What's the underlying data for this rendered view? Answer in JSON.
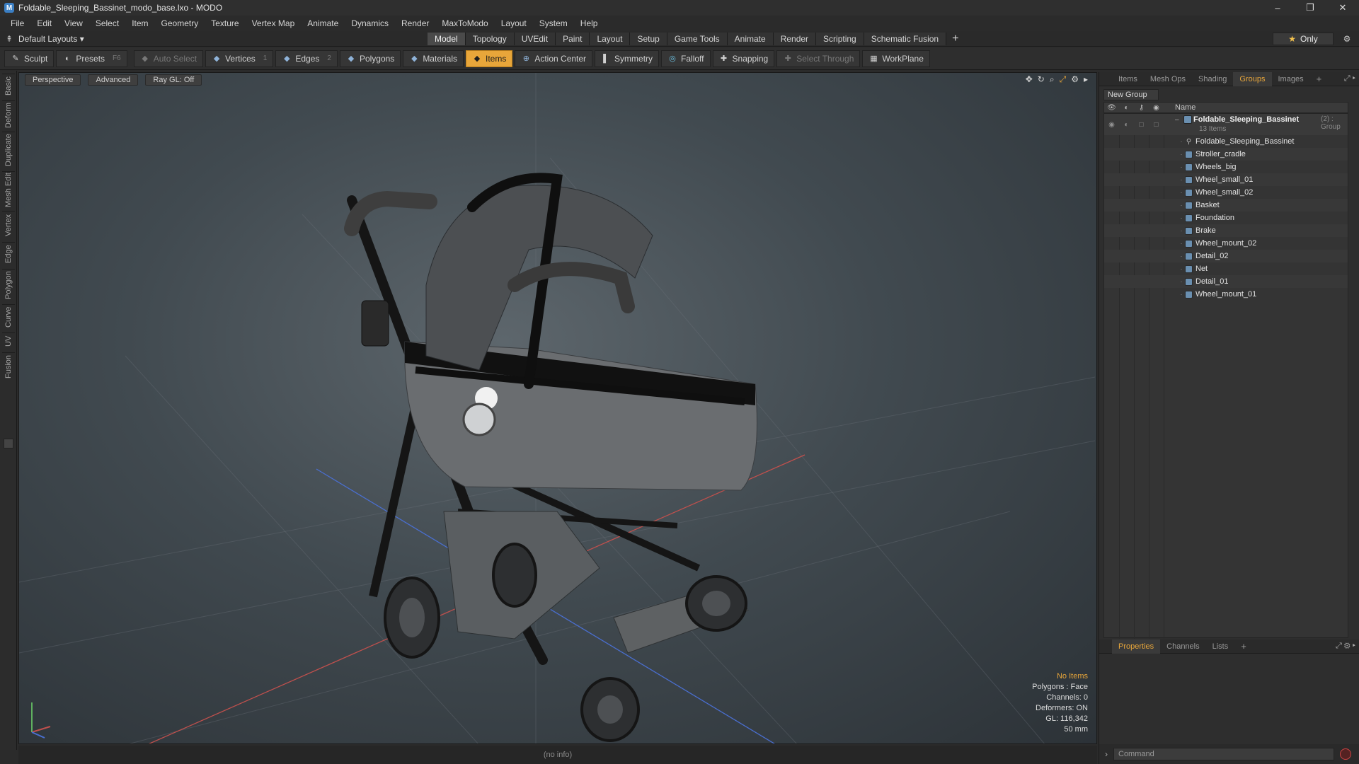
{
  "window": {
    "title": "Foldable_Sleeping_Bassinet_modo_base.lxo - MODO",
    "controls": [
      "–",
      "❐",
      "✕"
    ]
  },
  "menu": [
    "File",
    "Edit",
    "View",
    "Select",
    "Item",
    "Geometry",
    "Texture",
    "Vertex Map",
    "Animate",
    "Dynamics",
    "Render",
    "MaxToModo",
    "Layout",
    "System",
    "Help"
  ],
  "layouts": {
    "label": "Default Layouts ▾"
  },
  "tabs": {
    "items": [
      "Model",
      "Topology",
      "UVEdit",
      "Paint",
      "Layout",
      "Setup",
      "Game Tools",
      "Animate",
      "Render",
      "Scripting",
      "Schematic Fusion"
    ],
    "active": "Model",
    "plus": "+",
    "only_label": "Only",
    "only_icon": "★"
  },
  "toolbar": {
    "sculpt": "Sculpt",
    "presets": "Presets",
    "presets_key": "F6",
    "auto_select": "Auto Select",
    "vertices": "Vertices",
    "vertices_key": "1",
    "edges": "Edges",
    "edges_key": "2",
    "polygons": "Polygons",
    "materials": "Materials",
    "items": "Items",
    "action_center": "Action Center",
    "symmetry": "Symmetry",
    "falloff": "Falloff",
    "snapping": "Snapping",
    "select_through": "Select Through",
    "workplane": "WorkPlane"
  },
  "left_tabs": [
    "Basic",
    "Deform",
    "Duplicate",
    "Mesh Edit",
    "Vertex",
    "Edge",
    "Polygon",
    "Curve",
    "UV",
    "Fusion"
  ],
  "viewport": {
    "view_mode": "Perspective",
    "shading": "Advanced",
    "raygl": "Ray GL: Off",
    "info": {
      "selection": "No Items",
      "polygons": "Polygons : Face",
      "channels": "Channels: 0",
      "deformers": "Deformers: ON",
      "gl": "GL: 116,342",
      "distance": "50 mm"
    }
  },
  "status": {
    "text": "(no info)"
  },
  "right_panel": {
    "tabs": [
      "Items",
      "Mesh Ops",
      "Shading",
      "Groups",
      "Images"
    ],
    "active_tab": "Groups",
    "new_group": "New Group",
    "column_name": "Name",
    "group": {
      "name": "Foldable_Sleeping_Bassinet",
      "count": "(2) : Group",
      "subtitle": "13 Items"
    },
    "items": [
      "Foldable_Sleeping_Bassinet",
      "Stroller_cradle",
      "Wheels_big",
      "Wheel_small_01",
      "Wheel_small_02",
      "Basket",
      "Foundation",
      "Brake",
      "Wheel_mount_02",
      "Detail_02",
      "Net",
      "Detail_01",
      "Wheel_mount_01"
    ],
    "bottom_tabs": [
      "Properties",
      "Channels",
      "Lists"
    ],
    "bottom_active": "Properties",
    "command_placeholder": "Command"
  },
  "colors": {
    "accent": "#e8a63a",
    "panel": "#2e2e2e",
    "viewport_center": "#5d666c",
    "axis_x": "#c0504d",
    "axis_z": "#4a6fd0"
  }
}
